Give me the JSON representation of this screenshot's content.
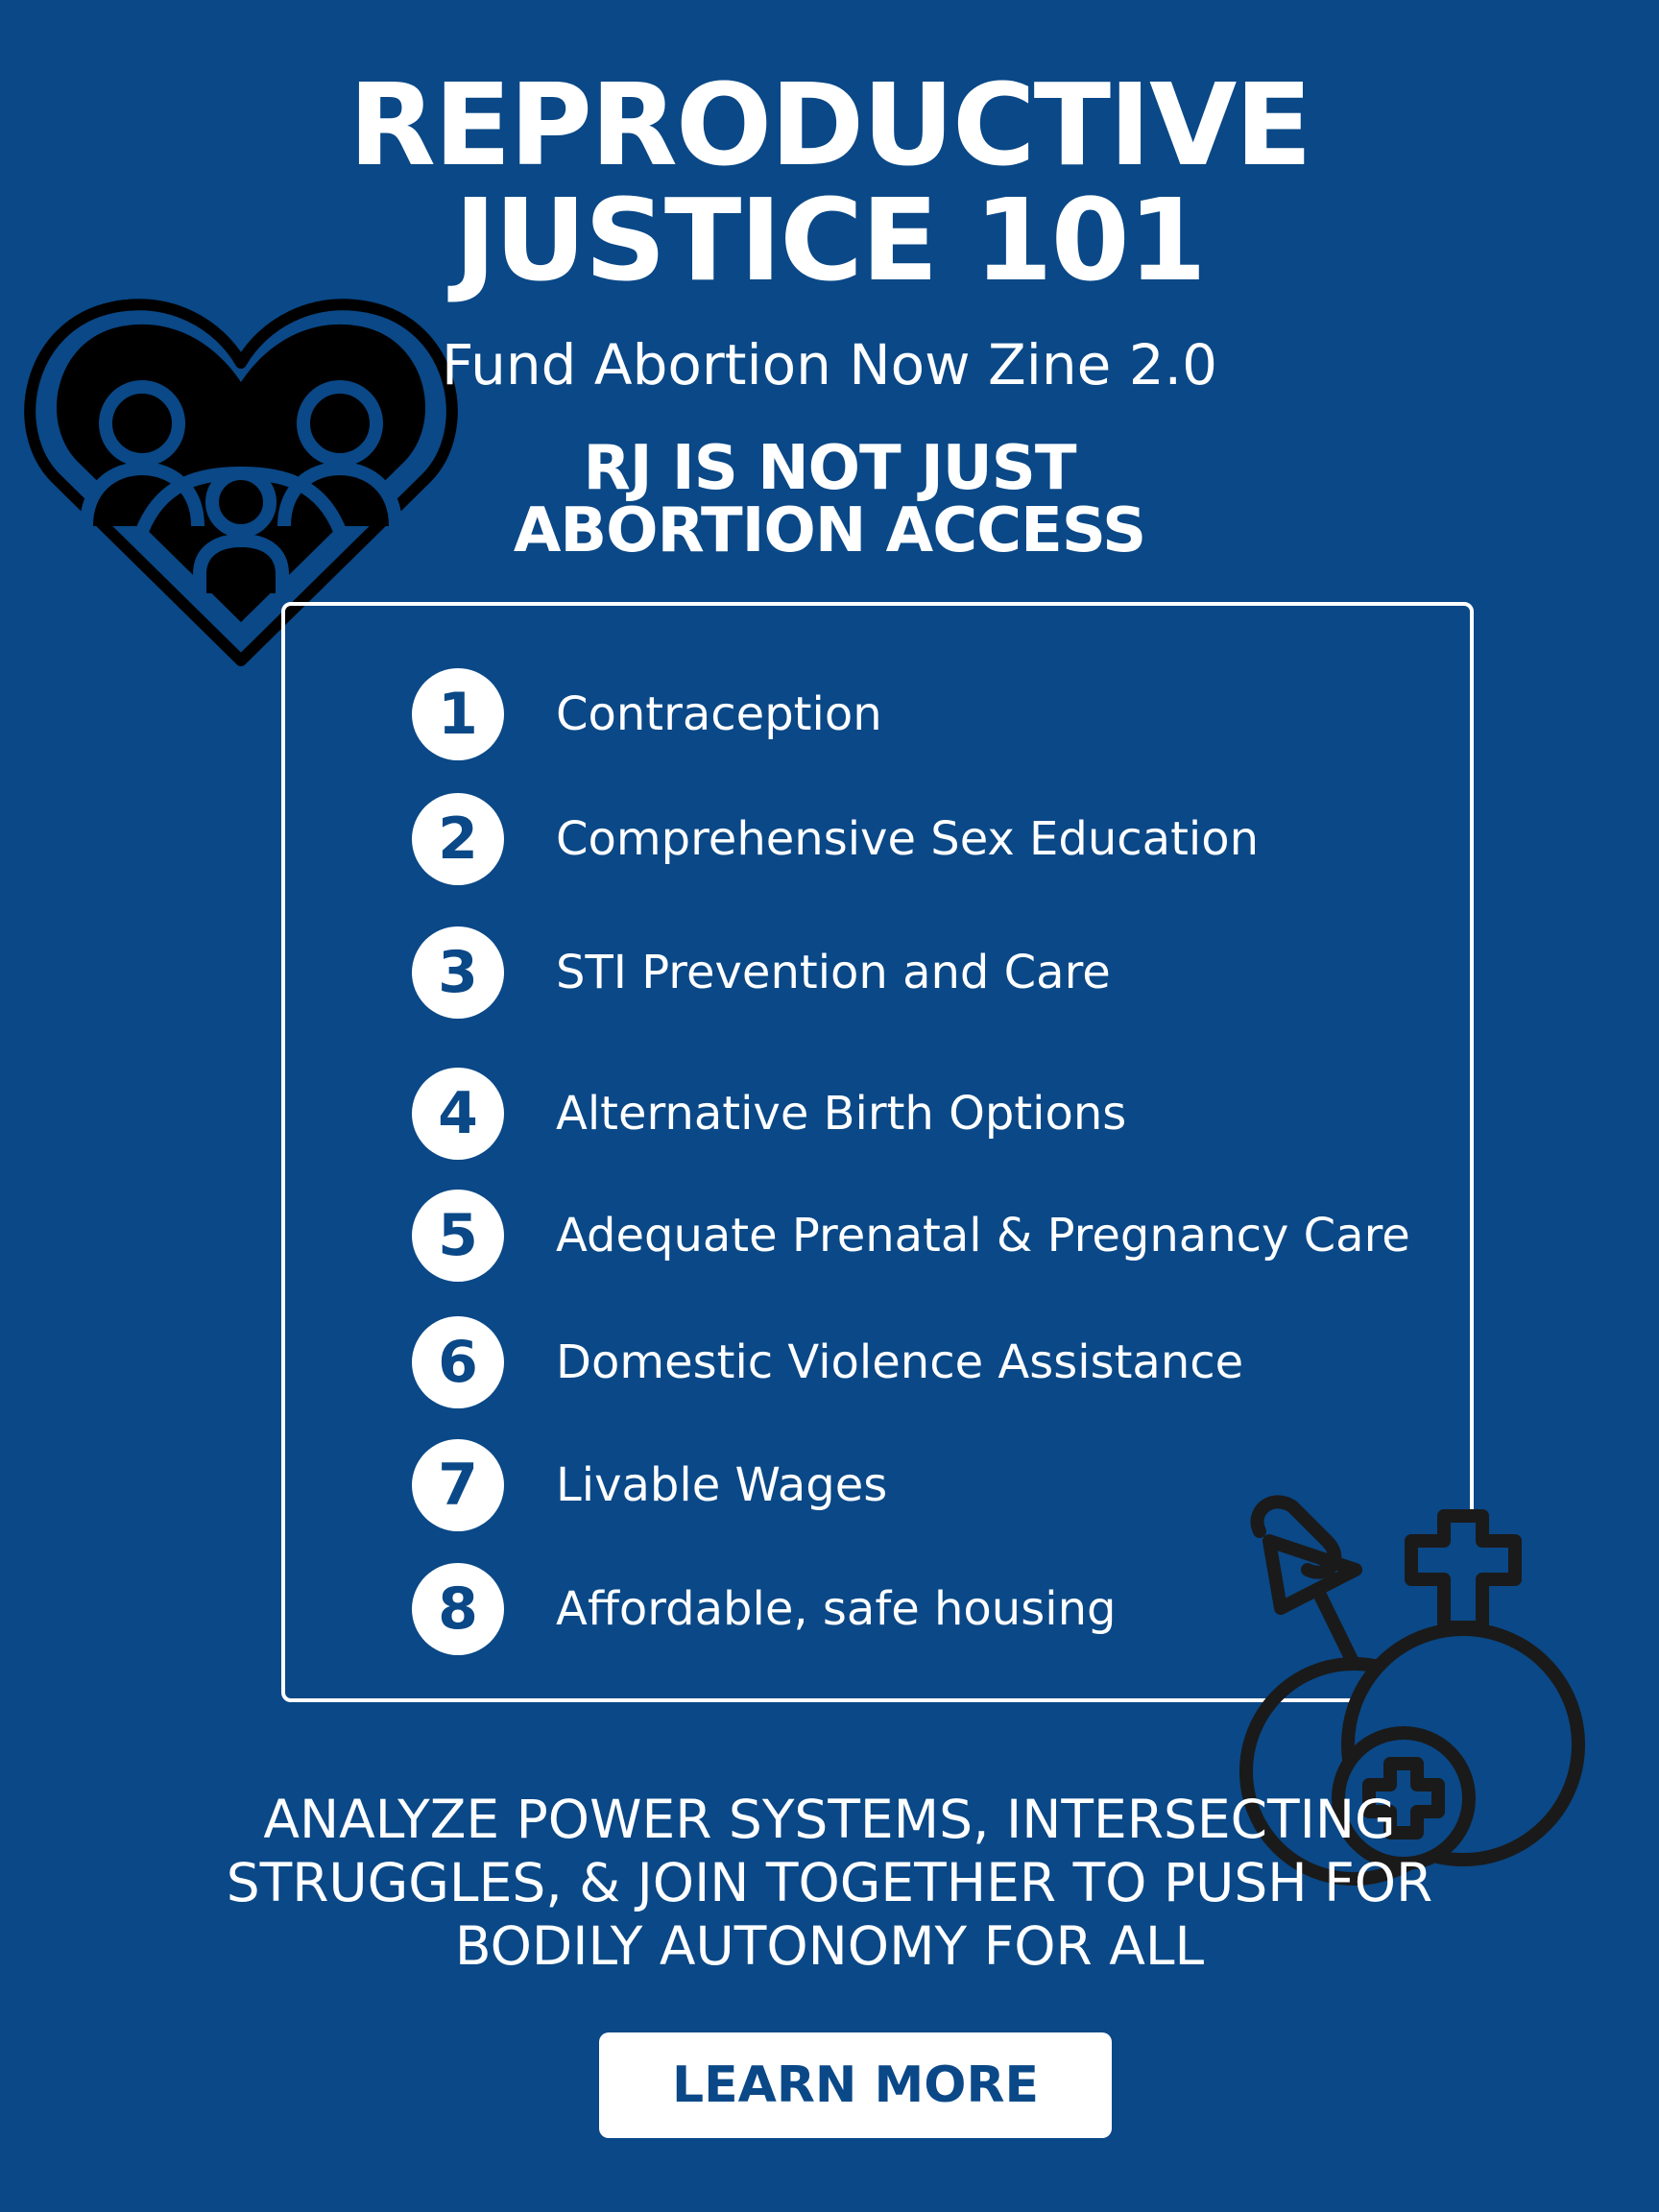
{
  "header": {
    "title_line1": "REPRODUCTIVE",
    "title_line2": "JUSTICE 101",
    "subtitle": "Fund Abortion Now Zine 2.0"
  },
  "section": {
    "heading_line1": "RJ IS NOT JUST",
    "heading_line2": "ABORTION ACCESS"
  },
  "list": {
    "items": [
      {
        "number": "1",
        "label": "Contraception"
      },
      {
        "number": "2",
        "label": "Comprehensive Sex Education"
      },
      {
        "number": "3",
        "label": "STI Prevention and Care"
      },
      {
        "number": "4",
        "label": "Alternative Birth Options"
      },
      {
        "number": "5",
        "label": "Adequate Prenatal & Pregnancy Care"
      },
      {
        "number": "6",
        "label": "Domestic Violence Assistance"
      },
      {
        "number": "7",
        "label": "Livable Wages"
      },
      {
        "number": "8",
        "label": "Affordable, safe housing"
      }
    ]
  },
  "tagline": {
    "line1": "ANALYZE POWER SYSTEMS, INTERSECTING",
    "line2": "STRUGGLES, & JOIN TOGETHER TO PUSH FOR",
    "line3": "BODILY AUTONOMY FOR ALL"
  },
  "cta": {
    "label": "LEARN MORE"
  },
  "icons": {
    "top_left": "heart-family-icon",
    "bottom_right": "gender-symbols-icon"
  },
  "colors": {
    "background": "#0a4887",
    "text": "#ffffff",
    "icon_stroke": "#000000",
    "icon_fill": "#0a4887"
  }
}
